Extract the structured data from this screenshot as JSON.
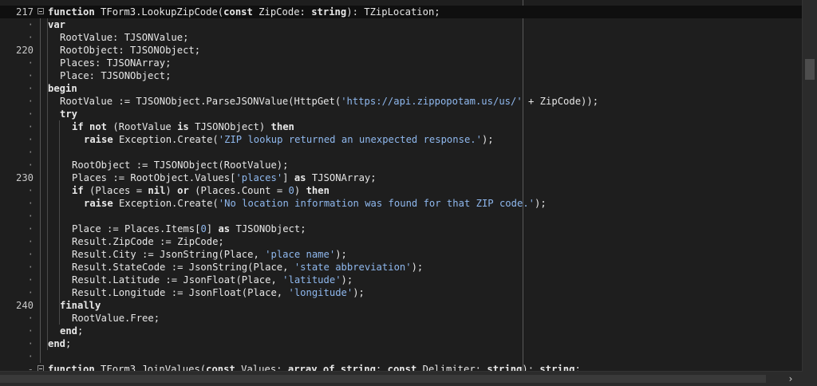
{
  "editor": {
    "lines": [
      {
        "ln": "217",
        "indent": 0,
        "fold": true,
        "current": true,
        "tokens": [
          [
            "kw",
            "function"
          ],
          [
            "id",
            " TForm3.LookupZipCode("
          ],
          [
            "kw",
            "const"
          ],
          [
            "id",
            " ZipCode: "
          ],
          [
            "kw",
            "string"
          ],
          [
            "id",
            "): TZipLocation;"
          ]
        ]
      },
      {
        "ln": "·",
        "indent": 0,
        "tokens": [
          [
            "kw",
            "var"
          ]
        ]
      },
      {
        "ln": "·",
        "indent": 1,
        "tokens": [
          [
            "id",
            "RootValue: TJSONValue;"
          ]
        ]
      },
      {
        "ln": "220",
        "indent": 1,
        "tokens": [
          [
            "id",
            "RootObject: TJSONObject;"
          ]
        ]
      },
      {
        "ln": "·",
        "indent": 1,
        "tokens": [
          [
            "id",
            "Places: TJSONArray;"
          ]
        ]
      },
      {
        "ln": "·",
        "indent": 1,
        "tokens": [
          [
            "id",
            "Place: TJSONObject;"
          ]
        ]
      },
      {
        "ln": "·",
        "indent": 0,
        "tokens": [
          [
            "kw",
            "begin"
          ]
        ]
      },
      {
        "ln": "·",
        "indent": 1,
        "tokens": [
          [
            "id",
            "RootValue := TJSONObject.ParseJSONValue(HttpGet("
          ],
          [
            "str",
            "'https://api.zippopotam.us/us/'"
          ],
          [
            "id",
            " + ZipCode));"
          ]
        ]
      },
      {
        "ln": "·",
        "indent": 1,
        "tokens": [
          [
            "kw",
            "try"
          ]
        ]
      },
      {
        "ln": "·",
        "indent": 2,
        "tokens": [
          [
            "kw",
            "if not"
          ],
          [
            "id",
            " (RootValue "
          ],
          [
            "kw",
            "is"
          ],
          [
            "id",
            " TJSONObject) "
          ],
          [
            "kw",
            "then"
          ]
        ]
      },
      {
        "ln": "·",
        "indent": 3,
        "tokens": [
          [
            "kw",
            "raise"
          ],
          [
            "id",
            " Exception.Create("
          ],
          [
            "str",
            "'ZIP lookup returned an unexpected response.'"
          ],
          [
            "id",
            ");"
          ]
        ]
      },
      {
        "ln": "·",
        "indent": 0,
        "tokens": []
      },
      {
        "ln": "·",
        "indent": 2,
        "tokens": [
          [
            "id",
            "RootObject := TJSONObject(RootValue);"
          ]
        ]
      },
      {
        "ln": "230",
        "indent": 2,
        "tokens": [
          [
            "id",
            "Places := RootObject.Values["
          ],
          [
            "str",
            "'places'"
          ],
          [
            "id",
            "] "
          ],
          [
            "kw",
            "as"
          ],
          [
            "id",
            " TJSONArray;"
          ]
        ]
      },
      {
        "ln": "·",
        "indent": 2,
        "tokens": [
          [
            "kw",
            "if"
          ],
          [
            "id",
            " (Places = "
          ],
          [
            "kw",
            "nil"
          ],
          [
            "id",
            ") "
          ],
          [
            "kw",
            "or"
          ],
          [
            "id",
            " (Places.Count = "
          ],
          [
            "num",
            "0"
          ],
          [
            "id",
            ") "
          ],
          [
            "kw",
            "then"
          ]
        ]
      },
      {
        "ln": "·",
        "indent": 3,
        "tokens": [
          [
            "kw",
            "raise"
          ],
          [
            "id",
            " Exception.Create("
          ],
          [
            "str",
            "'No location information was found for that ZIP code.'"
          ],
          [
            "id",
            ");"
          ]
        ]
      },
      {
        "ln": "·",
        "indent": 0,
        "tokens": []
      },
      {
        "ln": "·",
        "indent": 2,
        "tokens": [
          [
            "id",
            "Place := Places.Items["
          ],
          [
            "num",
            "0"
          ],
          [
            "id",
            "] "
          ],
          [
            "kw",
            "as"
          ],
          [
            "id",
            " TJSONObject;"
          ]
        ]
      },
      {
        "ln": "·",
        "indent": 2,
        "tokens": [
          [
            "id",
            "Result.ZipCode := ZipCode;"
          ]
        ]
      },
      {
        "ln": "·",
        "indent": 2,
        "tokens": [
          [
            "id",
            "Result.City := JsonString(Place, "
          ],
          [
            "str",
            "'place name'"
          ],
          [
            "id",
            ");"
          ]
        ]
      },
      {
        "ln": "·",
        "indent": 2,
        "tokens": [
          [
            "id",
            "Result.StateCode := JsonString(Place, "
          ],
          [
            "str",
            "'state abbreviation'"
          ],
          [
            "id",
            ");"
          ]
        ]
      },
      {
        "ln": "·",
        "indent": 2,
        "tokens": [
          [
            "id",
            "Result.Latitude := JsonFloat(Place, "
          ],
          [
            "str",
            "'latitude'"
          ],
          [
            "id",
            ");"
          ]
        ]
      },
      {
        "ln": "·",
        "indent": 2,
        "tokens": [
          [
            "id",
            "Result.Longitude := JsonFloat(Place, "
          ],
          [
            "str",
            "'longitude'"
          ],
          [
            "id",
            ");"
          ]
        ]
      },
      {
        "ln": "240",
        "indent": 1,
        "tokens": [
          [
            "kw",
            "finally"
          ]
        ]
      },
      {
        "ln": "·",
        "indent": 2,
        "tokens": [
          [
            "id",
            "RootValue.Free;"
          ]
        ]
      },
      {
        "ln": "·",
        "indent": 1,
        "tokens": [
          [
            "kw",
            "end"
          ],
          [
            "id",
            ";"
          ]
        ]
      },
      {
        "ln": "·",
        "indent": 0,
        "tokens": [
          [
            "kw",
            "end"
          ],
          [
            "id",
            ";"
          ]
        ]
      },
      {
        "ln": "·",
        "indent": 0,
        "tokens": []
      },
      {
        "ln": "-",
        "indent": 0,
        "fold": true,
        "tokens": [
          [
            "kw",
            "function"
          ],
          [
            "id",
            " TForm3.JoinValues("
          ],
          [
            "kw",
            "const"
          ],
          [
            "id",
            " Values: "
          ],
          [
            "kw",
            "array of string"
          ],
          [
            "id",
            "; "
          ],
          [
            "kw",
            "const"
          ],
          [
            "id",
            " Delimiter: "
          ],
          [
            "kw",
            "string"
          ],
          [
            "id",
            "): "
          ],
          [
            "kw",
            "string"
          ],
          [
            "id",
            ";"
          ]
        ]
      }
    ]
  },
  "scrollbar": {
    "right_arrow_icon": "chevron-right-icon",
    "right_arrow_glyph": "›"
  },
  "colors": {
    "background": "#1e1e1e",
    "keyword": "#e8e8e8",
    "string": "#8fb8ee",
    "current_line": "#0f0f0f"
  }
}
